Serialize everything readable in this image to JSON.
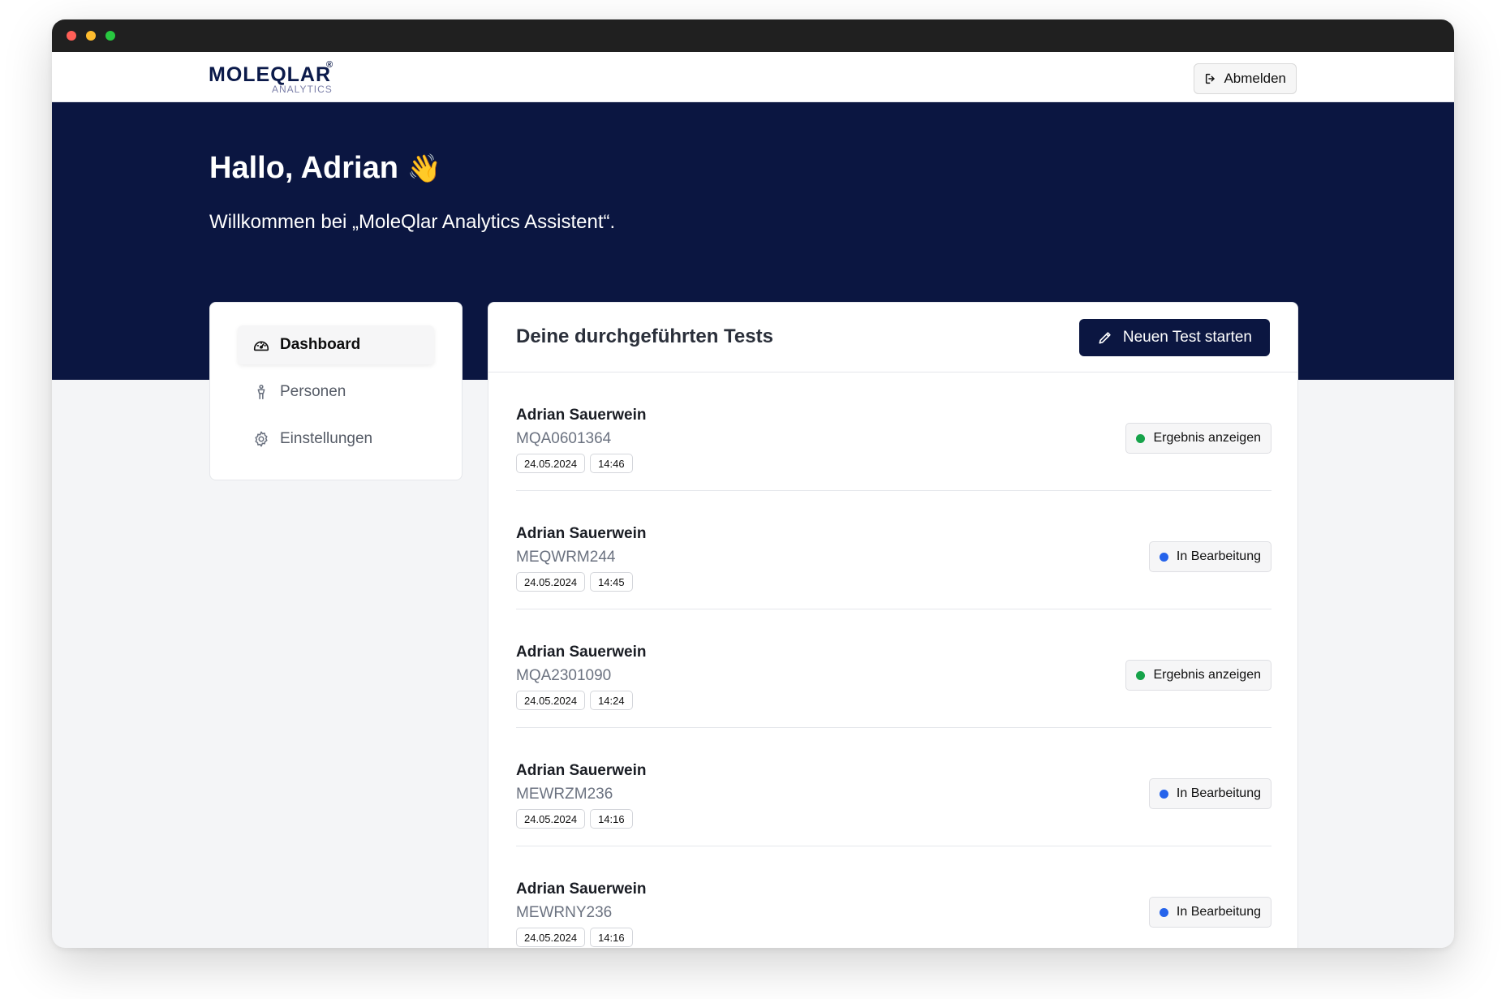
{
  "brand": {
    "name": "MOLEQLAR",
    "registered": "®",
    "sub": "ANALYTICS"
  },
  "header": {
    "logout_label": "Abmelden"
  },
  "hero": {
    "greeting": "Hallo, Adrian",
    "wave": "👋",
    "welcome": "Willkommen bei „MoleQlar Analytics Assistent“."
  },
  "sidebar": {
    "items": [
      {
        "label": "Dashboard",
        "icon": "dashboard-gauge-icon",
        "active": true
      },
      {
        "label": "Personen",
        "icon": "person-icon",
        "active": false
      },
      {
        "label": "Einstellungen",
        "icon": "gear-icon",
        "active": false
      }
    ]
  },
  "main": {
    "title": "Deine durchgeführten Tests",
    "new_test_label": "Neuen Test starten",
    "new_test_icon": "pencil-icon",
    "tests": [
      {
        "name": "Adrian Sauerwein",
        "code": "MQA0601364",
        "date": "24.05.2024",
        "time": "14:46",
        "status": "Ergebnis anzeigen",
        "status_color": "#16a34a"
      },
      {
        "name": "Adrian Sauerwein",
        "code": "MEQWRM244",
        "date": "24.05.2024",
        "time": "14:45",
        "status": "In Bearbeitung",
        "status_color": "#2563eb"
      },
      {
        "name": "Adrian Sauerwein",
        "code": "MQA2301090",
        "date": "24.05.2024",
        "time": "14:24",
        "status": "Ergebnis anzeigen",
        "status_color": "#16a34a"
      },
      {
        "name": "Adrian Sauerwein",
        "code": "MEWRZM236",
        "date": "24.05.2024",
        "time": "14:16",
        "status": "In Bearbeitung",
        "status_color": "#2563eb"
      },
      {
        "name": "Adrian Sauerwein",
        "code": "MEWRNY236",
        "date": "24.05.2024",
        "time": "14:16",
        "status": "In Bearbeitung",
        "status_color": "#2563eb"
      }
    ]
  },
  "colors": {
    "navy": "#0b1641",
    "success": "#16a34a",
    "progress": "#2563eb"
  }
}
